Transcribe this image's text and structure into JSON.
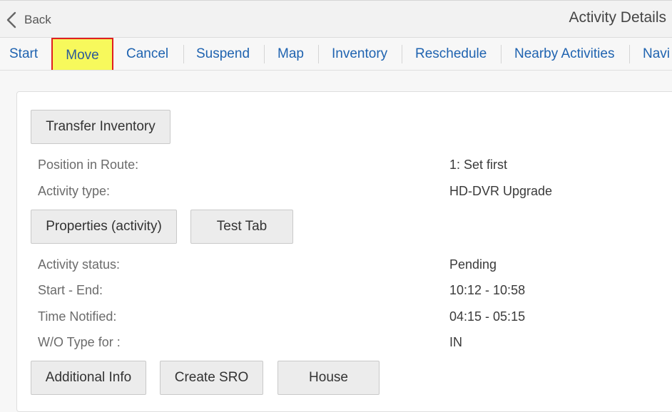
{
  "header": {
    "back_label": "Back",
    "title": "Activity Details"
  },
  "toolbar": {
    "items": [
      "Start",
      "Move",
      "Cancel",
      "Suspend",
      "Map",
      "Inventory",
      "Reschedule",
      "Nearby Activities",
      "Navi"
    ],
    "highlighted": "Move",
    "highlight_color": "#f7f95c",
    "highlight_border_color": "#e02020",
    "link_color": "#1f63b0"
  },
  "buttons": {
    "transfer_inventory": "Transfer Inventory",
    "properties": "Properties (activity)",
    "test_tab": "Test Tab",
    "additional_info": "Additional Info",
    "create_sro": "Create SRO",
    "house": "House"
  },
  "details": {
    "position_label": "Position in Route:",
    "position_value": "1: Set first",
    "type_label": "Activity type:",
    "type_value": "HD-DVR Upgrade",
    "status_label": "Activity status:",
    "status_value": "Pending",
    "start_end_label": "Start - End:",
    "start_end_value": "10:12 - 10:58",
    "notified_label": "Time Notified:",
    "notified_value": "04:15 - 05:15",
    "wo_type_label": "W/O Type for :",
    "wo_type_value": "IN"
  }
}
